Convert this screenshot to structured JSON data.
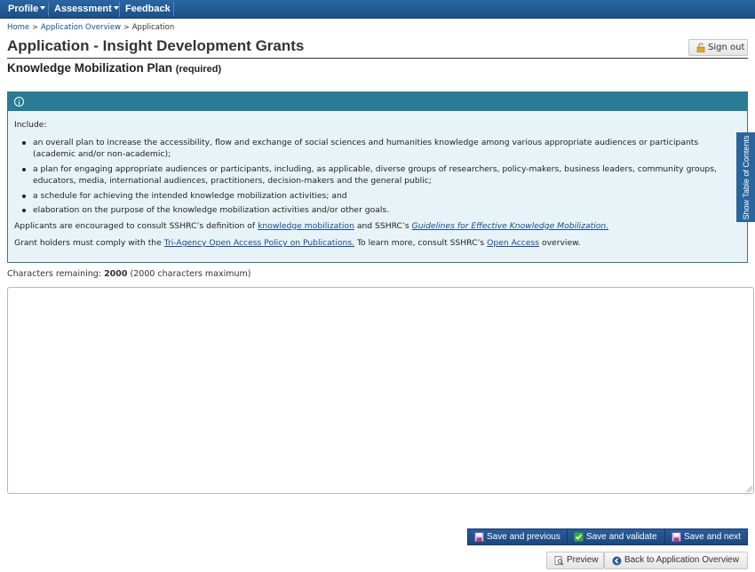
{
  "nav": {
    "profile": "Profile",
    "assessment": "Assessment",
    "feedback": "Feedback"
  },
  "breadcrumb": {
    "home": "Home",
    "overview": "Application Overview",
    "current": "Application"
  },
  "page": {
    "title": "Application - Insight Development Grants",
    "sign_out": "Sign out"
  },
  "section": {
    "title": "Knowledge Mobilization Plan",
    "required": "(required)"
  },
  "info": {
    "intro": "Include:",
    "items": [
      "an overall plan to increase the accessibility, flow and exchange of social sciences and humanities knowledge among various appropriate audiences or participants (academic and/or non-academic);",
      "a plan for engaging appropriate audiences or participants, including, as applicable, diverse groups of researchers, policy-makers, business leaders, community groups, educators, media, international audiences, practitioners, decision-makers and the general public;",
      "a schedule for achieving the intended knowledge mobilization activities; and",
      "elaboration on the purpose of the knowledge mobilization activities and/or other goals."
    ],
    "para1_a": "Applicants are encouraged to consult SSHRC’s definition of ",
    "para1_link1": "knowledge mobilization",
    "para1_b": " and SSHRC’s ",
    "para1_link2": "Guidelines for Effective Knowledge Mobilization.",
    "para2_a": "Grant holders must comply with the ",
    "para2_link1": "Tri-Agency Open Access Policy on Publications.",
    "para2_b": " To learn more, consult SSHRC’s ",
    "para2_link2": "Open Access",
    "para2_c": " overview."
  },
  "toc_tab": "Show Table of Contents",
  "chars": {
    "label": "Characters remaining: ",
    "count": "2000",
    "max": " (2000 characters maximum)"
  },
  "textarea": {
    "value": ""
  },
  "buttons": {
    "save_previous": "Save and previous",
    "save_validate": "Save and validate",
    "save_next": "Save and next",
    "preview": "Preview",
    "back_overview": "Back to Application Overview"
  },
  "colors": {
    "nav_bg": "#1c4f86",
    "info_header": "#2a7b95",
    "info_bg": "#e8f3f8",
    "link": "#1a4a8a",
    "button_blue": "#1c477c"
  }
}
